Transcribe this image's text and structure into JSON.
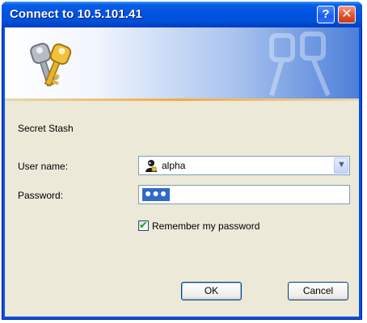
{
  "window": {
    "title": "Connect to 10.5.101.41",
    "help_glyph": "?",
    "close_glyph": "✕"
  },
  "dialog": {
    "realm": "Secret Stash",
    "user_label": "User name:",
    "user_value": "alpha",
    "password_label": "Password:",
    "password_value": "●●●",
    "remember_label": "Remember my password",
    "remember_checked": true,
    "check_glyph": "✔",
    "dropdown_glyph": "▼",
    "ok_label": "OK",
    "cancel_label": "Cancel"
  },
  "colors": {
    "title_bar": "#0054e3",
    "client_bg": "#ece9d8",
    "selection": "#316ac5",
    "check": "#21a121"
  },
  "icons": [
    "keys-icon",
    "user-icon",
    "help-icon",
    "close-icon",
    "checkmark-icon",
    "chevron-down-icon"
  ]
}
